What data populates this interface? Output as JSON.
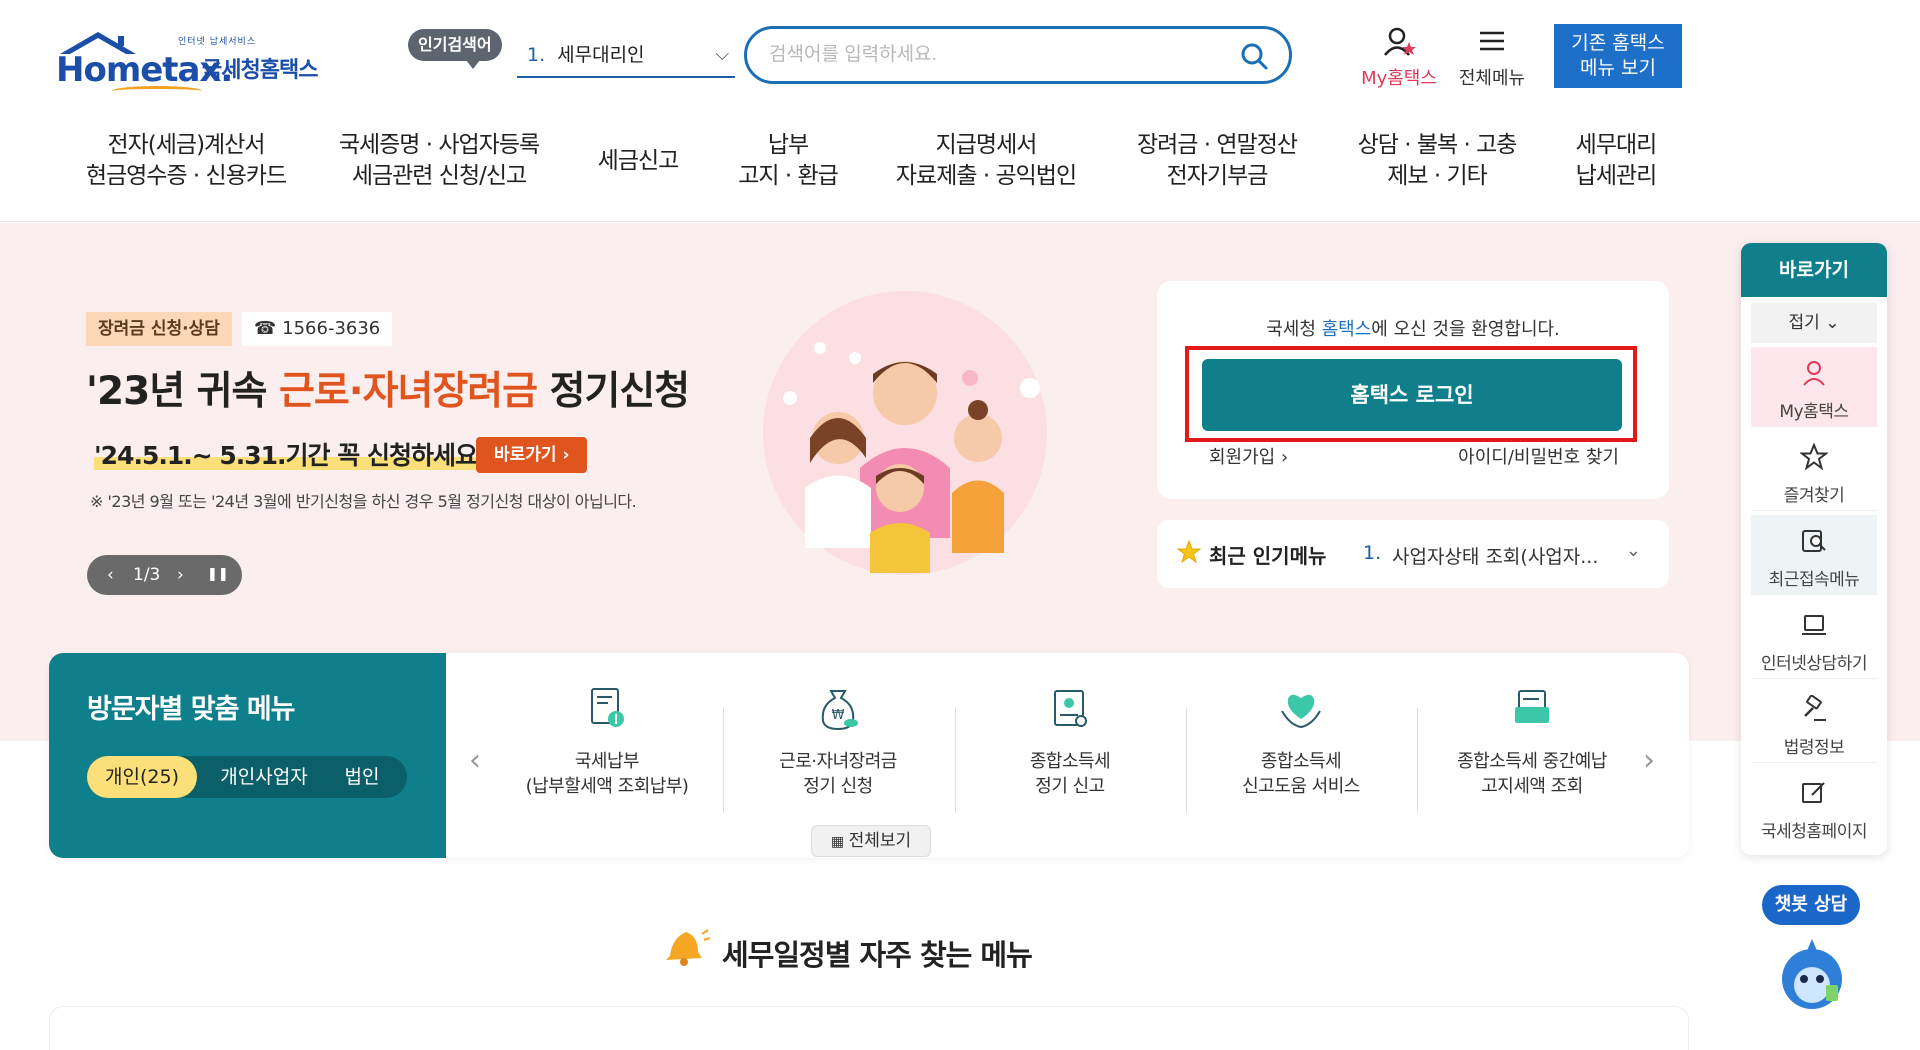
{
  "header": {
    "logo_top": "인터넷 납세서비스",
    "logo_word": "Hometax.",
    "logo_kname": "국세청홈택스",
    "popular_badge": "인기검색어",
    "popular_num": "1.",
    "popular_value": "세무대리인",
    "search_placeholder": "검색어를 입력하세요.",
    "myhome_label": "My홈택스",
    "allmenu_label": "전체메뉴",
    "old_hometax_label": "기존 홈택스\n메뉴 보기"
  },
  "gnb": {
    "items": [
      "전자(세금)계산서\n현금영수증 · 신용카드",
      "국세증명 · 사업자등록\n세금관련 신청/신고",
      "세금신고",
      "납부\n고지 · 환급",
      "지급명세서\n자료제출 · 공익법인",
      "장려금 · 연말정산\n전자기부금",
      "상담 · 불복 · 고충\n제보 · 기타",
      "세무대리\n납세관리"
    ]
  },
  "hero": {
    "tag1": "장려금 신청·상담",
    "tag2": "☎ 1566-3636",
    "title_pre": "'23년 귀속 ",
    "title_hl": "근로·자녀장려금",
    "title_post": " 정기신청",
    "sub": "'24.5.1.~ 5.31.기간 꼭 신청하세요!",
    "go_label": "바로가기 ›",
    "note": "※ '23년 9월 또는 '24년 3월에 반기신청을 하신 경우 5월 정기신청 대상이 아닙니다.",
    "pager": {
      "prev": "‹",
      "page": "1/3",
      "next": "›",
      "pause": "❚❚"
    }
  },
  "login": {
    "welcome_pre": "국세청 ",
    "welcome_link": "홈택스",
    "welcome_post": "에 오신 것을 환영합니다.",
    "login_button": "홈택스 로그인",
    "join": "회원가입 ›",
    "find": "아이디/비밀번호 찾기"
  },
  "popular_menu": {
    "title": "최근 인기메뉴",
    "num": "1.",
    "value": "사업자상태 조회(사업자...",
    "chevron": "⌄"
  },
  "visitor": {
    "title": "방문자별 맞춤 메뉴",
    "tabs": [
      "개인(25)",
      "개인사업자",
      "법인"
    ],
    "cards": [
      "국세납부\n(납부할세액 조회납부)",
      "근로·자녀장려금\n정기 신청",
      "종합소득세\n정기 신고",
      "종합소득세\n신고도움 서비스",
      "종합소득세 중간예납\n고지세액 조회"
    ],
    "prev": "‹",
    "next": "›",
    "all_view": "전체보기"
  },
  "schedule": {
    "title": "세무일정별 자주 찾는 메뉴"
  },
  "quickbar": {
    "head": "바로가기",
    "fold": "접기 ⌄",
    "items": [
      "My홈택스",
      "즐겨찾기",
      "최근접속메뉴",
      "인터넷상담하기",
      "법령정보",
      "국세청홈페이지"
    ]
  },
  "chatbot": {
    "label": "챗봇 상담"
  },
  "colors": {
    "teal": "#0e7f8b",
    "brand_blue": "#1a4ea8",
    "accent_orange": "#e0541e",
    "highlight_red_box": "#e31919",
    "hero_band": "#fbeeee"
  }
}
